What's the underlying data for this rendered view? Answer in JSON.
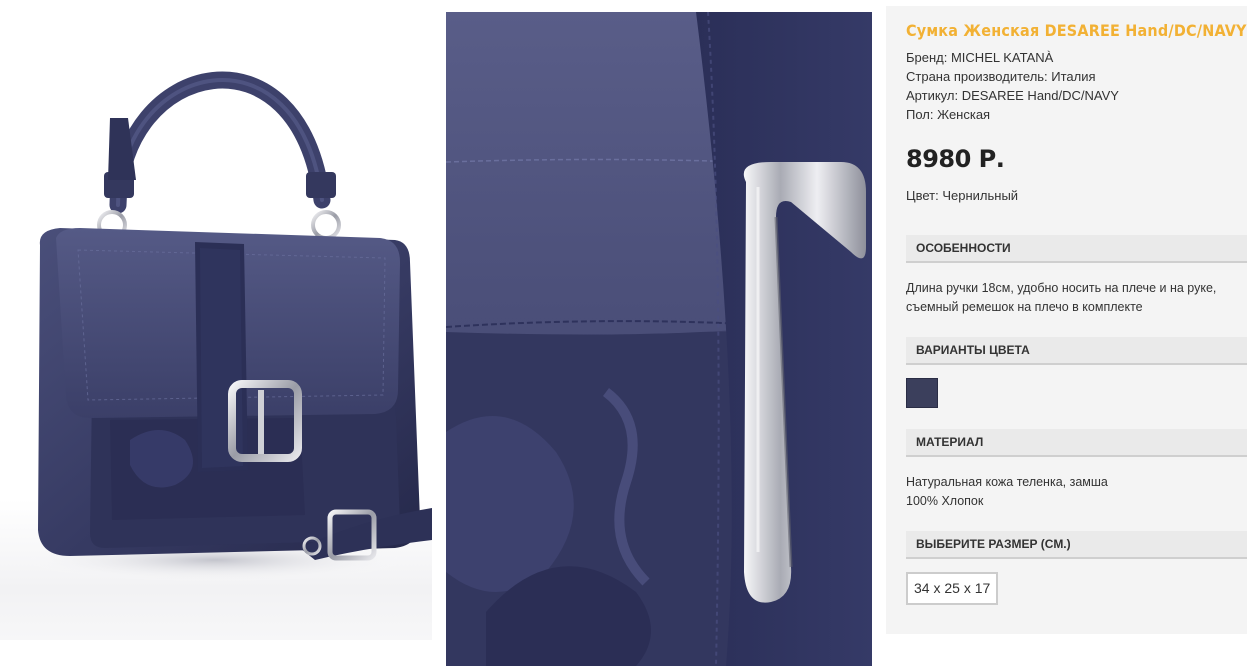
{
  "product": {
    "title": "Сумка Женская DESAREE Hand/DC/NAVY",
    "brand": "Бренд: MICHEL KATANÀ",
    "country": "Страна производитель: Италия",
    "sku": "Артикул: DESAREE Hand/DC/NAVY",
    "gender": "Пол: Женская",
    "price": "8980 Р.",
    "color": "Цвет: Чернильный"
  },
  "sections": {
    "features": {
      "header": "ОСОБЕННОСТИ",
      "text": "Длина ручки 18см, удобно носить на плече и на руке, съемный ремешок на плечо в комплекте"
    },
    "color_variants": {
      "header": "ВАРИАНТЫ ЦВЕТА",
      "swatches": [
        {
          "color": "#3b3f5c",
          "name": "Чернильный"
        }
      ]
    },
    "material": {
      "header": "МАТЕРИАЛ",
      "line1": "Натуральная кожа теленка, замша",
      "line2": "100% Хлопок"
    },
    "size": {
      "header": "ВЫБЕРИТЕ РАЗМЕР (СМ.)",
      "options": [
        "34 x 25 x 17"
      ]
    }
  },
  "colors": {
    "accent_title": "#f2b134",
    "bag_navy": "#3a3e63",
    "panel_bg": "#f4f4f4"
  },
  "images": {
    "main": "navy-handbag-photo",
    "detail": "buckle-closeup-photo"
  }
}
